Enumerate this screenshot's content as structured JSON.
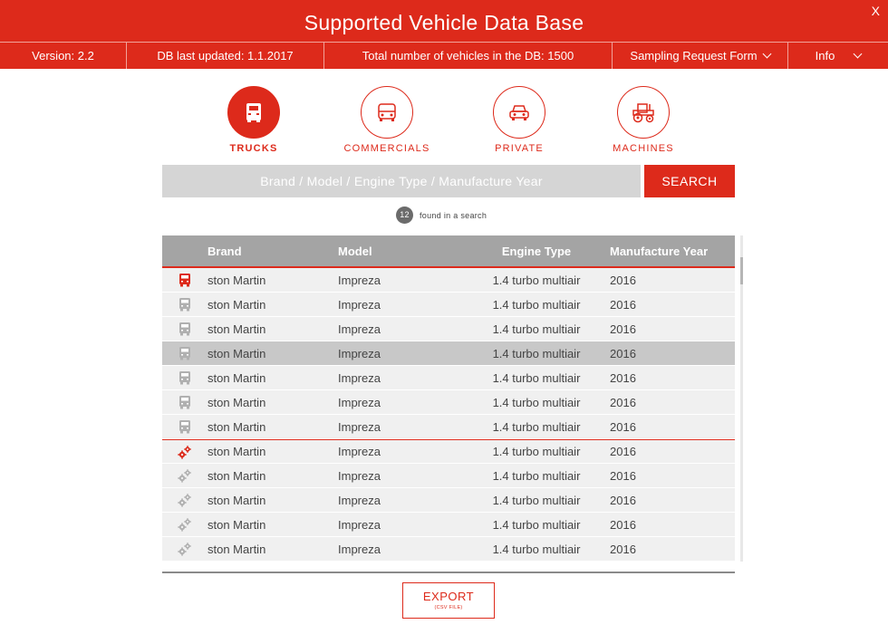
{
  "window": {
    "title": "Supported Vehicle Data Base",
    "close_label": "X"
  },
  "infobar": {
    "version": "Version: 2.2",
    "db_updated": "DB last updated: 1.1.2017",
    "total": "Total number of vehicles in the DB: 1500",
    "sampling": "Sampling Request Form",
    "info": "Info"
  },
  "categories": [
    {
      "label": "TRUCKS",
      "icon": "truck-icon",
      "active": true
    },
    {
      "label": "COMMERCIALS",
      "icon": "van-icon",
      "active": false
    },
    {
      "label": "PRIVATE",
      "icon": "car-icon",
      "active": false
    },
    {
      "label": "MACHINES",
      "icon": "tractor-icon",
      "active": false
    }
  ],
  "search": {
    "placeholder": "Brand / Model / Engine Type / Manufacture Year",
    "button_label": "SEARCH"
  },
  "results": {
    "count": "12",
    "label": "found in a search"
  },
  "table": {
    "headers": {
      "brand": "Brand",
      "model": "Model",
      "engine": "Engine Type",
      "year": "Manufacture Year"
    },
    "rows": [
      {
        "icon": "truck-icon",
        "highlight": true,
        "selected": false,
        "brand": "ston Martin",
        "model": "Impreza",
        "engine": "1.4 turbo multiair",
        "year": "2016"
      },
      {
        "icon": "truck-icon",
        "highlight": false,
        "selected": false,
        "brand": "ston Martin",
        "model": "Impreza",
        "engine": "1.4 turbo multiair",
        "year": "2016"
      },
      {
        "icon": "truck-icon",
        "highlight": false,
        "selected": false,
        "brand": "ston Martin",
        "model": "Impreza",
        "engine": "1.4 turbo multiair",
        "year": "2016"
      },
      {
        "icon": "truck-icon",
        "highlight": false,
        "selected": true,
        "brand": "ston Martin",
        "model": "Impreza",
        "engine": "1.4 turbo multiair",
        "year": "2016"
      },
      {
        "icon": "truck-icon",
        "highlight": false,
        "selected": false,
        "brand": "ston Martin",
        "model": "Impreza",
        "engine": "1.4 turbo multiair",
        "year": "2016"
      },
      {
        "icon": "truck-icon",
        "highlight": false,
        "selected": false,
        "brand": "ston Martin",
        "model": "Impreza",
        "engine": "1.4 turbo multiair",
        "year": "2016"
      },
      {
        "icon": "truck-icon",
        "highlight": false,
        "selected": false,
        "brand": "ston Martin",
        "model": "Impreza",
        "engine": "1.4 turbo multiair",
        "year": "2016"
      },
      {
        "icon": "gears-icon",
        "highlight": true,
        "selected": false,
        "brand": "ston Martin",
        "model": "Impreza",
        "engine": "1.4 turbo multiair",
        "year": "2016"
      },
      {
        "icon": "gears-icon",
        "highlight": false,
        "selected": false,
        "brand": "ston Martin",
        "model": "Impreza",
        "engine": "1.4 turbo multiair",
        "year": "2016"
      },
      {
        "icon": "gears-icon",
        "highlight": false,
        "selected": false,
        "brand": "ston Martin",
        "model": "Impreza",
        "engine": "1.4 turbo multiair",
        "year": "2016"
      },
      {
        "icon": "gears-icon",
        "highlight": false,
        "selected": false,
        "brand": "ston Martin",
        "model": "Impreza",
        "engine": "1.4 turbo multiair",
        "year": "2016"
      },
      {
        "icon": "gears-icon",
        "highlight": false,
        "selected": false,
        "brand": "ston Martin",
        "model": "Impreza",
        "engine": "1.4 turbo multiair",
        "year": "2016"
      }
    ]
  },
  "export": {
    "label": "EXPORT",
    "sublabel": "(CSV FILE)"
  },
  "colors": {
    "accent": "#dd2a1b",
    "header_gray": "#a4a4a4",
    "row_bg": "#f0f0f0",
    "row_selected": "#c8c8c8",
    "icon_gray": "#b0b0b0"
  }
}
